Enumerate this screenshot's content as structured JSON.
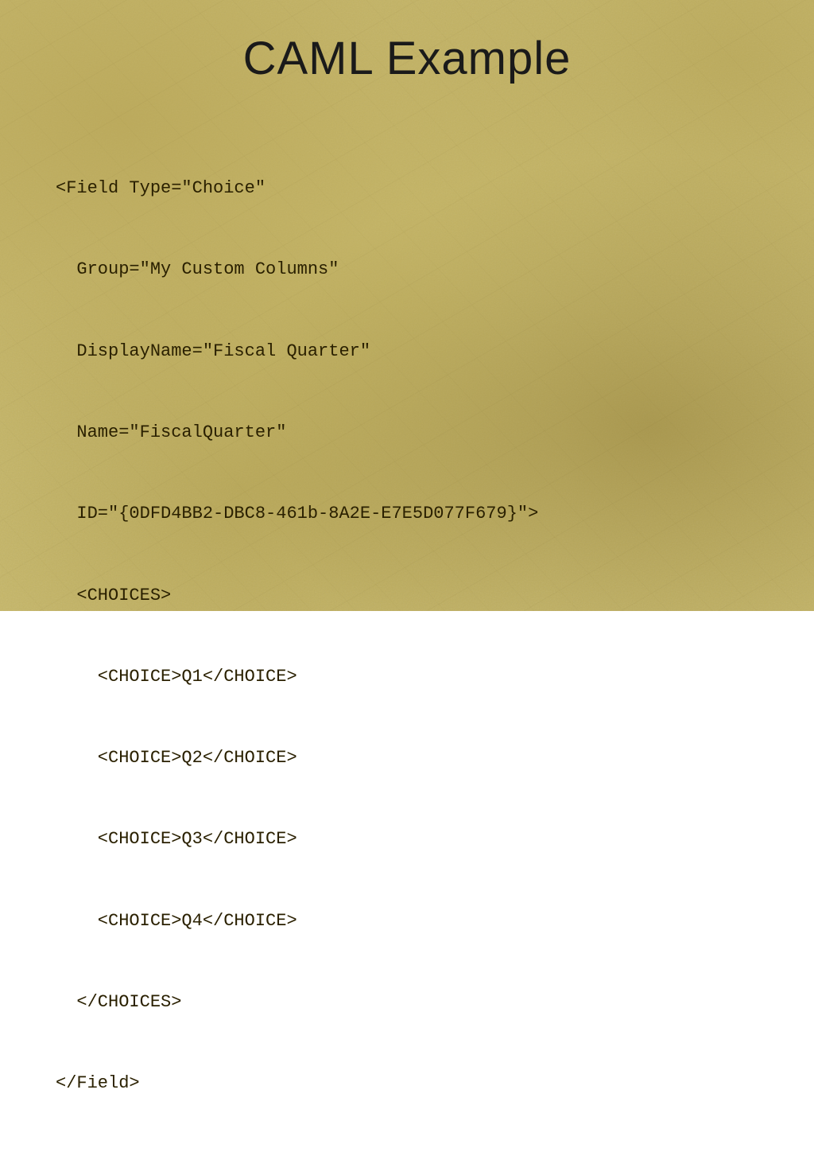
{
  "slide": {
    "title": "CAML Example",
    "code": {
      "lines": [
        "<Field Type=\"Choice\"",
        "  Group=\"My Custom Columns\"",
        "  DisplayName=\"Fiscal Quarter\"",
        "  Name=\"FiscalQuarter\"",
        "  ID=\"{0DFD4BB2-DBC8-461b-8A2E-E7E5D077F679}\">",
        "  <CHOICES>",
        "    <CHOICE>Q1</CHOICE>",
        "    <CHOICE>Q2</CHOICE>",
        "    <CHOICE>Q3</CHOICE>",
        "    <CHOICE>Q4</CHOICE>",
        "  </CHOICES>",
        "</Field>"
      ]
    }
  }
}
